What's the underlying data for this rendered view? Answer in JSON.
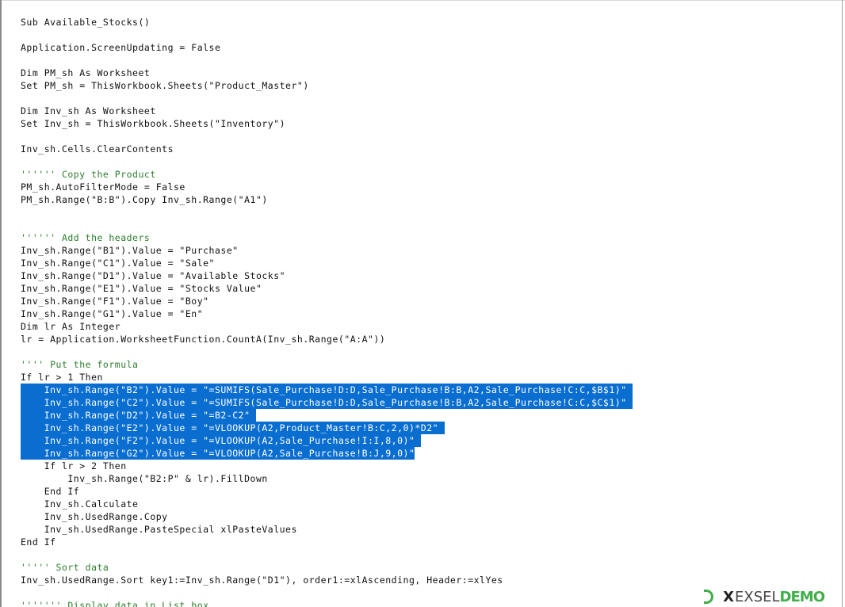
{
  "code_lines": [
    {
      "text": "Sub Available_Stocks()",
      "style": "normal"
    },
    {
      "text": "",
      "style": "normal"
    },
    {
      "text": "Application.ScreenUpdating = False",
      "style": "normal"
    },
    {
      "text": "",
      "style": "normal"
    },
    {
      "text": "Dim PM_sh As Worksheet",
      "style": "normal"
    },
    {
      "text": "Set PM_sh = ThisWorkbook.Sheets(\"Product_Master\")",
      "style": "normal"
    },
    {
      "text": "",
      "style": "normal"
    },
    {
      "text": "Dim Inv_sh As Worksheet",
      "style": "normal"
    },
    {
      "text": "Set Inv_sh = ThisWorkbook.Sheets(\"Inventory\")",
      "style": "normal"
    },
    {
      "text": "",
      "style": "normal"
    },
    {
      "text": "Inv_sh.Cells.ClearContents",
      "style": "normal"
    },
    {
      "text": "",
      "style": "normal"
    },
    {
      "text": "'''''' Copy the Product",
      "style": "comment"
    },
    {
      "text": "PM_sh.AutoFilterMode = False",
      "style": "normal"
    },
    {
      "text": "PM_sh.Range(\"B:B\").Copy Inv_sh.Range(\"A1\")",
      "style": "normal"
    },
    {
      "text": "",
      "style": "normal"
    },
    {
      "text": "",
      "style": "normal"
    },
    {
      "text": "'''''' Add the headers",
      "style": "comment"
    },
    {
      "text": "Inv_sh.Range(\"B1\").Value = \"Purchase\"",
      "style": "normal"
    },
    {
      "text": "Inv_sh.Range(\"C1\").Value = \"Sale\"",
      "style": "normal"
    },
    {
      "text": "Inv_sh.Range(\"D1\").Value = \"Available Stocks\"",
      "style": "normal"
    },
    {
      "text": "Inv_sh.Range(\"E1\").Value = \"Stocks Value\"",
      "style": "normal"
    },
    {
      "text": "Inv_sh.Range(\"F1\").Value = \"Boy\"",
      "style": "normal"
    },
    {
      "text": "Inv_sh.Range(\"G1\").Value = \"En\"",
      "style": "normal"
    },
    {
      "text": "Dim lr As Integer",
      "style": "normal"
    },
    {
      "text": "lr = Application.WorksheetFunction.CountA(Inv_sh.Range(\"A:A\"))",
      "style": "normal"
    },
    {
      "text": "",
      "style": "normal"
    },
    {
      "text": "'''' Put the formula",
      "style": "comment"
    },
    {
      "text": "If lr > 1 Then",
      "style": "normal",
      "sel_tail": "  "
    },
    {
      "text": "    Inv_sh.Range(\"B2\").Value = \"=SUMIFS(Sale_Purchase!D:D,Sale_Purchase!B:B,A2,Sale_Purchase!C:C,$B$1)\" ",
      "style": "sel"
    },
    {
      "text": "    Inv_sh.Range(\"C2\").Value = \"=SUMIFS(Sale_Purchase!D:D,Sale_Purchase!B:B,A2,Sale_Purchase!C:C,$C$1)\" ",
      "style": "sel"
    },
    {
      "text": "    Inv_sh.Range(\"D2\").Value = \"=B2-C2\" ",
      "style": "sel"
    },
    {
      "text": "    Inv_sh.Range(\"E2\").Value = \"=VLOOKUP(A2,Product_Master!B:C,2,0)*D2\" ",
      "style": "sel"
    },
    {
      "text": "    Inv_sh.Range(\"F2\").Value = \"=VLOOKUP(A2,Sale_Purchase!I:I,8,0)\" ",
      "style": "sel"
    },
    {
      "text": "    Inv_sh.Range(\"G2\").Value = \"=VLOOKUP(A2,Sale_Purchase!B:J,9,0)\"",
      "style": "sel"
    },
    {
      "text": "    If lr > 2 Then",
      "style": "normal"
    },
    {
      "text": "        Inv_sh.Range(\"B2:P\" & lr).FillDown",
      "style": "normal"
    },
    {
      "text": "    End If",
      "style": "normal"
    },
    {
      "text": "    Inv_sh.Calculate",
      "style": "normal"
    },
    {
      "text": "    Inv_sh.UsedRange.Copy",
      "style": "normal"
    },
    {
      "text": "    Inv_sh.UsedRange.PasteSpecial xlPasteValues",
      "style": "normal"
    },
    {
      "text": "End If",
      "style": "normal"
    },
    {
      "text": "",
      "style": "normal"
    },
    {
      "text": "''''' Sort data",
      "style": "comment"
    },
    {
      "text": "Inv_sh.UsedRange.Sort key1:=Inv_sh.Range(\"D1\"), order1:=xlAscending, Header:=xlYes",
      "style": "normal"
    },
    {
      "text": "",
      "style": "normal"
    },
    {
      "text": "''''''' Display data in List box",
      "style": "comment"
    }
  ],
  "watermark": {
    "x": "X",
    "exs": "EXSEL",
    "demo": "DEMO",
    "logo_color": "#3fae49"
  },
  "colors": {
    "selection": "#0a6ed1",
    "comment": "#2d7d2d"
  }
}
